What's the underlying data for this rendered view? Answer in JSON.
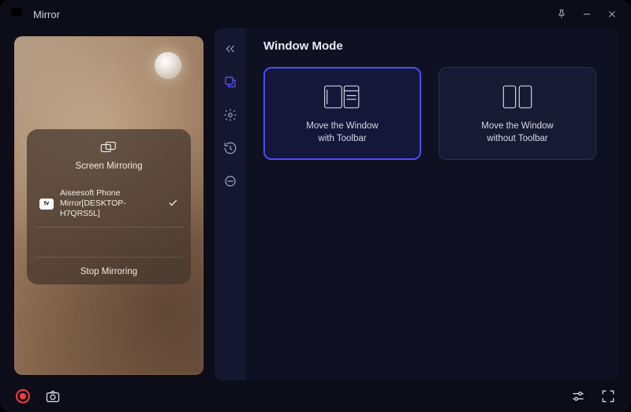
{
  "titlebar": {
    "title": "Mirror"
  },
  "phone": {
    "panel_title": "Screen Mirroring",
    "device_badge": "tv",
    "device_name": "Aiseesoft Phone Mirror[DESKTOP-H7QRS5L]",
    "stop_label": "Stop Mirroring"
  },
  "settings": {
    "heading": "Window Mode",
    "cards": [
      {
        "label": "Move the Window\nwith Toolbar",
        "selected": true
      },
      {
        "label": "Move the Window\nwithout Toolbar",
        "selected": false
      }
    ]
  }
}
